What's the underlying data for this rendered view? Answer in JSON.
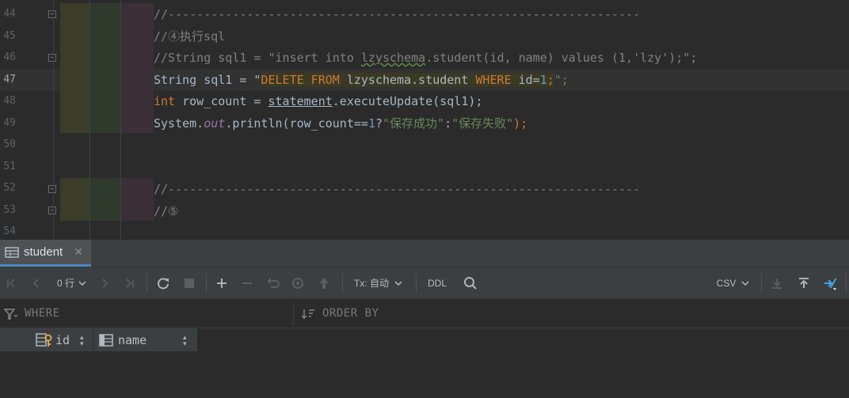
{
  "editor": {
    "line_numbers": [
      "44",
      "45",
      "46",
      "47",
      "48",
      "49",
      "50",
      "51",
      "52",
      "53",
      "54"
    ],
    "current_line": "47",
    "lines": {
      "l44": "//------------------------------------------------------------------",
      "l45": "//④执行sql",
      "l46_a": "//String sql1 = \"insert into ",
      "l46_b": "lzyschema",
      "l46_c": ".student(id, name) values (1,'lzy');\";",
      "l47_a": "String sql1 = \"",
      "l47_kw1": "DELETE FROM",
      "l47_b": " lzyschema.student ",
      "l47_kw2": "WHERE",
      "l47_c": " id=",
      "l47_num": "1",
      "l47_d": ";",
      "l47_e": "\";",
      "l48_kw": "int",
      "l48_a": " row_count = ",
      "l48_b": "statement",
      "l48_c": ".executeUpdate(sql1);",
      "l49_a": "System.",
      "l49_fld": "out",
      "l49_b": ".println(row_count==",
      "l49_num": "1",
      "l49_c": "?",
      "l49_s1": "\"保存成功\"",
      "l49_d": ":",
      "l49_s2": "\"保存失败\"",
      "l49_e": ");",
      "l52": "//------------------------------------------------------------------",
      "l53": "//⑤"
    }
  },
  "panel": {
    "tab": {
      "label": "student",
      "close": "✕",
      "icon": "table-icon"
    },
    "toolbar": {
      "row_count": "0 行",
      "tx_label": "Tx: 自动",
      "ddl": "DDL",
      "csv": "CSV"
    },
    "filter": {
      "where": "WHERE",
      "order_by": "ORDER BY"
    },
    "columns": [
      {
        "name": "id",
        "icon": "primary-key-icon"
      },
      {
        "name": "name",
        "icon": "column-icon"
      }
    ]
  },
  "colors": {
    "keyword": "#cc7832",
    "string": "#6a8759",
    "number": "#6897bb",
    "comment": "#808080",
    "field": "#9876aa",
    "accent": "#4a88c7"
  }
}
